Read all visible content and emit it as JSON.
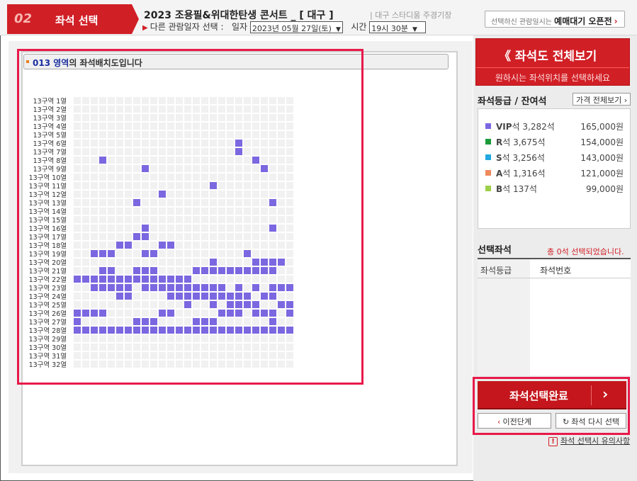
{
  "header": {
    "step_number": "02",
    "step_label": "좌석 선택",
    "concert_title": "2023 조용필&위대한탄생 콘서트 _ [ 대구 ]",
    "venue": "| 대구 스타디움 주경기장",
    "other_date_label": "다른 관람일자 선택 :",
    "date_label": "일자",
    "date_value": "2023년 05월 27일(토)",
    "time_label": "시간",
    "time_value": "19시 30분",
    "queue_prefix": "선택하신 관람일시는",
    "queue_label": "예매대기 오픈전"
  },
  "zone": {
    "zone_name": "013 영역",
    "zone_suffix": "의 좌석배치도입니다"
  },
  "seatmap": {
    "columns": 26,
    "colors": {
      "empty": "#f1f1f1",
      "available": "#7b68e0"
    },
    "rows": [
      {
        "label": "13구역 1열",
        "available": []
      },
      {
        "label": "13구역 2열",
        "available": []
      },
      {
        "label": "13구역 3열",
        "available": []
      },
      {
        "label": "13구역 4열",
        "available": []
      },
      {
        "label": "13구역 5열",
        "available": []
      },
      {
        "label": "13구역 6열",
        "available": [
          19
        ]
      },
      {
        "label": "13구역 7열",
        "available": [
          19
        ]
      },
      {
        "label": "13구역 8열",
        "available": [
          3,
          21
        ]
      },
      {
        "label": "13구역 9열",
        "available": [
          8,
          22
        ]
      },
      {
        "label": "13구역 10열",
        "available": []
      },
      {
        "label": "13구역 11열",
        "available": [
          16
        ]
      },
      {
        "label": "13구역 12열",
        "available": [
          10
        ]
      },
      {
        "label": "13구역 13열",
        "available": [
          7,
          23
        ]
      },
      {
        "label": "13구역 14열",
        "available": []
      },
      {
        "label": "13구역 15열",
        "available": []
      },
      {
        "label": "13구역 16열",
        "available": [
          8,
          23
        ]
      },
      {
        "label": "13구역 17열",
        "available": [
          7,
          8
        ]
      },
      {
        "label": "13구역 18열",
        "available": [
          5,
          6,
          10,
          11
        ]
      },
      {
        "label": "13구역 19열",
        "available": [
          2,
          3,
          4,
          8,
          9,
          20
        ]
      },
      {
        "label": "13구역 20열",
        "available": [
          16,
          21,
          22,
          23,
          24
        ]
      },
      {
        "label": "13구역 21열",
        "available": [
          3,
          4,
          7,
          8,
          9,
          14,
          15,
          16,
          17,
          18,
          19,
          20,
          21,
          22,
          23
        ]
      },
      {
        "label": "13구역 22열",
        "available": [
          0,
          1,
          2,
          3,
          4,
          5,
          6,
          7,
          8,
          9,
          10,
          11,
          12,
          13
        ]
      },
      {
        "label": "13구역 23열",
        "available": [
          2,
          3,
          4,
          5,
          6,
          8,
          9,
          10,
          11,
          12,
          13,
          14,
          15,
          16,
          17,
          19,
          21,
          23,
          24,
          25
        ]
      },
      {
        "label": "13구역 24열",
        "available": [
          5,
          6,
          11,
          12,
          13,
          14,
          15,
          16,
          17,
          18,
          19,
          20,
          22,
          23
        ]
      },
      {
        "label": "13구역 25열",
        "available": [
          13,
          16,
          18,
          19,
          20,
          21,
          24,
          25
        ]
      },
      {
        "label": "13구역 26열",
        "available": [
          0,
          1,
          2,
          3,
          10,
          11,
          17,
          18,
          19,
          21,
          22,
          23,
          25
        ]
      },
      {
        "label": "13구역 27열",
        "available": [
          0,
          7,
          8,
          9,
          14,
          15,
          16,
          23
        ]
      },
      {
        "label": "13구역 28열",
        "available": [
          0,
          1,
          2,
          3,
          4,
          5,
          6,
          7,
          8,
          9,
          10,
          11,
          12,
          13,
          14,
          15,
          16,
          17,
          18,
          19,
          20,
          21,
          22,
          23,
          24,
          25
        ]
      },
      {
        "label": "13구역 29열",
        "available": []
      },
      {
        "label": "13구역 30열",
        "available": []
      },
      {
        "label": "13구역 31열",
        "available": []
      },
      {
        "label": "13구역 32열",
        "available": []
      }
    ]
  },
  "sidebar": {
    "full_view_title": "《 좌석도 전체보기",
    "full_view_subtitle": "원하시는 좌석위치를 선택하세요",
    "grade_title": "좌석등급 / 잔여석",
    "price_button": "가격 전체보기 ›",
    "grades": [
      {
        "grade": "VIP",
        "rest": "석 3,282석",
        "price": "165,000원",
        "color": "#7b68e0"
      },
      {
        "grade": "R",
        "rest": "석 3,675석",
        "price": "154,000원",
        "color": "#1a9a3a"
      },
      {
        "grade": "S",
        "rest": "석 3,256석",
        "price": "143,000원",
        "color": "#22a7e0"
      },
      {
        "grade": "A",
        "rest": "석 1,316석",
        "price": "121,000원",
        "color": "#f08a5d"
      },
      {
        "grade": "B",
        "rest": "석 137석",
        "price": "99,000원",
        "color": "#9ed04a"
      }
    ],
    "selected_title": "선택좌석",
    "selected_count": "총 0석 선택되었습니다.",
    "col_grade": "좌석등급",
    "col_number": "좌석번호",
    "complete_button": "좌석선택완료",
    "prev_button": "이전단계",
    "reselect_button": "좌석 다시 선택",
    "notice_link": "좌석 선택시 유의사항"
  }
}
